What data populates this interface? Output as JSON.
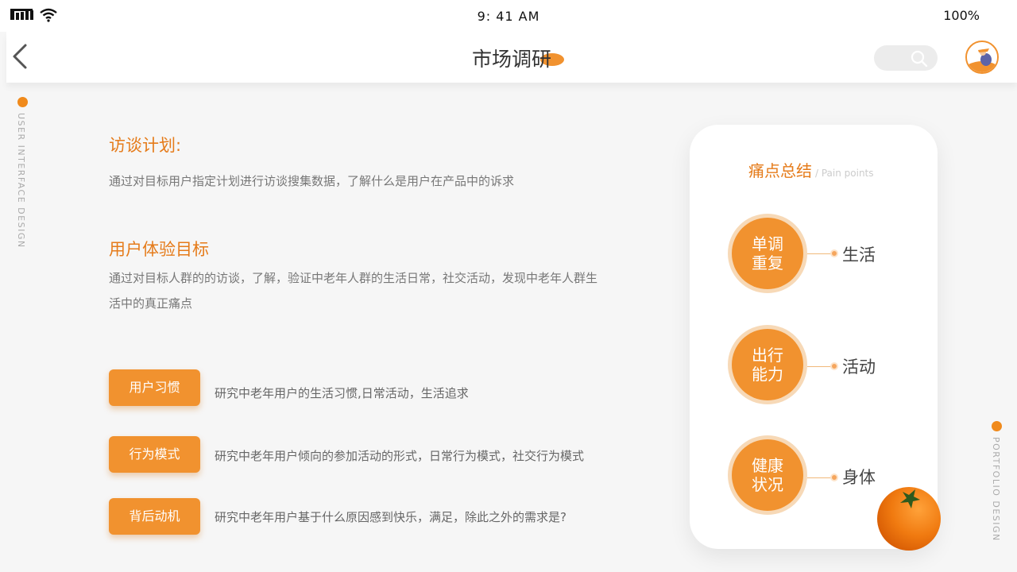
{
  "status": {
    "time": "9: 41 AM",
    "battery": "100%"
  },
  "nav": {
    "title": "市场调研"
  },
  "side": {
    "left": "USER INTERFACE DESIGN",
    "right": "PORTFOLIO DESIGN"
  },
  "sections": {
    "interview": {
      "title": "访谈计划:",
      "text": "通过对目标用户指定计划进行访谈搜集数据，了解什么是用户在产品中的诉求"
    },
    "goals": {
      "title": "用户体验目标",
      "text": "通过对目标人群的的访谈，了解，验证中老年人群的生活日常，社交活动，发现中老年人群生活中的真正痛点"
    }
  },
  "tags": [
    {
      "label": "用户习惯",
      "desc": "研究中老年用户的生活习惯,日常活动，生活追求"
    },
    {
      "label": "行为模式",
      "desc": "研究中老年用户倾向的参加活动的形式，日常行为模式，社交行为模式"
    },
    {
      "label": "背后动机",
      "desc": "研究中老年用户基于什么原因感到快乐，满足，除此之外的需求是?"
    }
  ],
  "painpoints": {
    "title": "痛点总结",
    "subtitle": "/ Pain points",
    "items": [
      {
        "circle": "单调重复",
        "label": "生活"
      },
      {
        "circle": "出行能力",
        "label": "活动"
      },
      {
        "circle": "健康状况",
        "label": "身体"
      }
    ]
  },
  "colors": {
    "accent": "#f1922f",
    "accent_dark": "#e57b1a"
  },
  "icons": [
    "signal-icon",
    "wifi-icon",
    "back-arrow-icon",
    "search-icon",
    "avatar",
    "orange-illustration"
  ]
}
